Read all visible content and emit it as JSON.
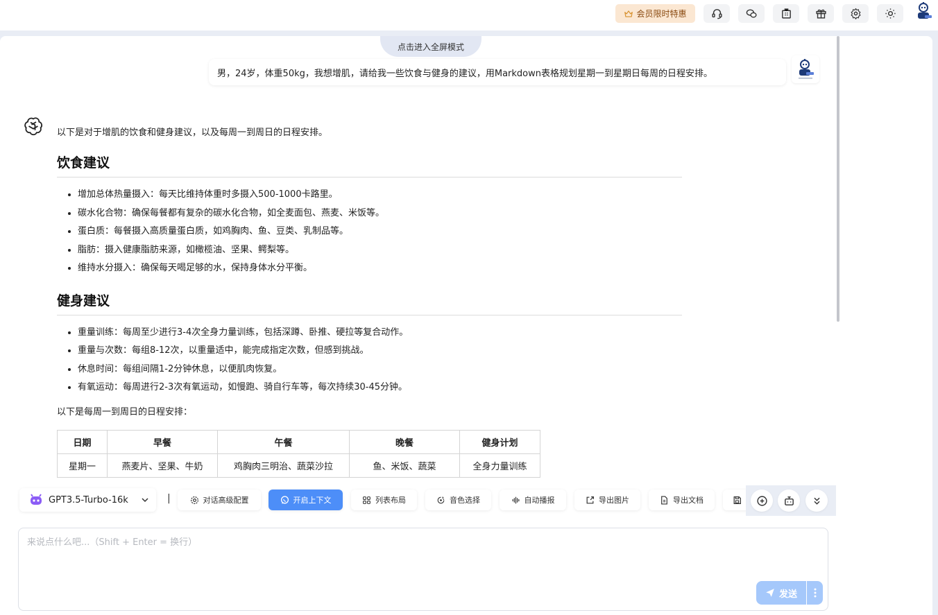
{
  "topbar": {
    "vip_label": "会员限时特惠",
    "icons": [
      "headset-icon",
      "wechat-icon",
      "building-icon",
      "gift-icon",
      "gear-icon",
      "sun-icon"
    ]
  },
  "chat": {
    "fullscreen_label": "点击进入全屏模式",
    "user_message": "男，24岁，体重50kg，我想增肌，请给我一些饮食与健身的建议，用Markdown表格规划星期一到星期日每周的日程安排。",
    "ai": {
      "intro": "以下是对于增肌的饮食和健身建议，以及每周一到周日的日程安排。",
      "diet_heading": "饮食建议",
      "diet_items": [
        "增加总体热量摄入：每天比维持体重时多摄入500-1000卡路里。",
        "碳水化合物：确保每餐都有复杂的碳水化合物，如全麦面包、燕麦、米饭等。",
        "蛋白质：每餐摄入高质量蛋白质，如鸡胸肉、鱼、豆类、乳制品等。",
        "脂肪：摄入健康脂肪来源，如橄榄油、坚果、鳄梨等。",
        "维持水分摄入：确保每天喝足够的水，保持身体水分平衡。"
      ],
      "fitness_heading": "健身建议",
      "fitness_items": [
        "重量训练：每周至少进行3-4次全身力量训练，包括深蹲、卧推、硬拉等复合动作。",
        "重量与次数：每组8-12次，以重量适中，能完成指定次数，但感到挑战。",
        "休息时间：每组间隔1-2分钟休息，以便肌肉恢复。",
        "有氧运动：每周进行2-3次有氧运动，如慢跑、骑自行车等，每次持续30-45分钟。"
      ],
      "schedule_intro": "以下是每周一到周日的日程安排：",
      "table": {
        "headers": [
          "日期",
          "早餐",
          "午餐",
          "晚餐",
          "健身计划"
        ],
        "rows": [
          [
            "星期一",
            "燕麦片、坚果、牛奶",
            "鸡胸肉三明治、蔬菜沙拉",
            "鱼、米饭、蔬菜",
            "全身力量训练"
          ]
        ]
      }
    }
  },
  "toolbar": {
    "model": "GPT3.5-Turbo-16k",
    "separator": "|",
    "tools": [
      "对话高级配置",
      "开启上下文",
      "列表布局",
      "音色选择",
      "自动播报",
      "导出图片",
      "导出文档"
    ]
  },
  "input": {
    "placeholder": "来说点什么吧...（Shift + Enter = 换行）",
    "value": "",
    "send_label": "发送"
  },
  "colors": {
    "accent": "#4d8ef8",
    "send_disabled": "#a5c8fb",
    "vip_bg": "#fbe7d2",
    "vip_text": "#8a4a10"
  }
}
